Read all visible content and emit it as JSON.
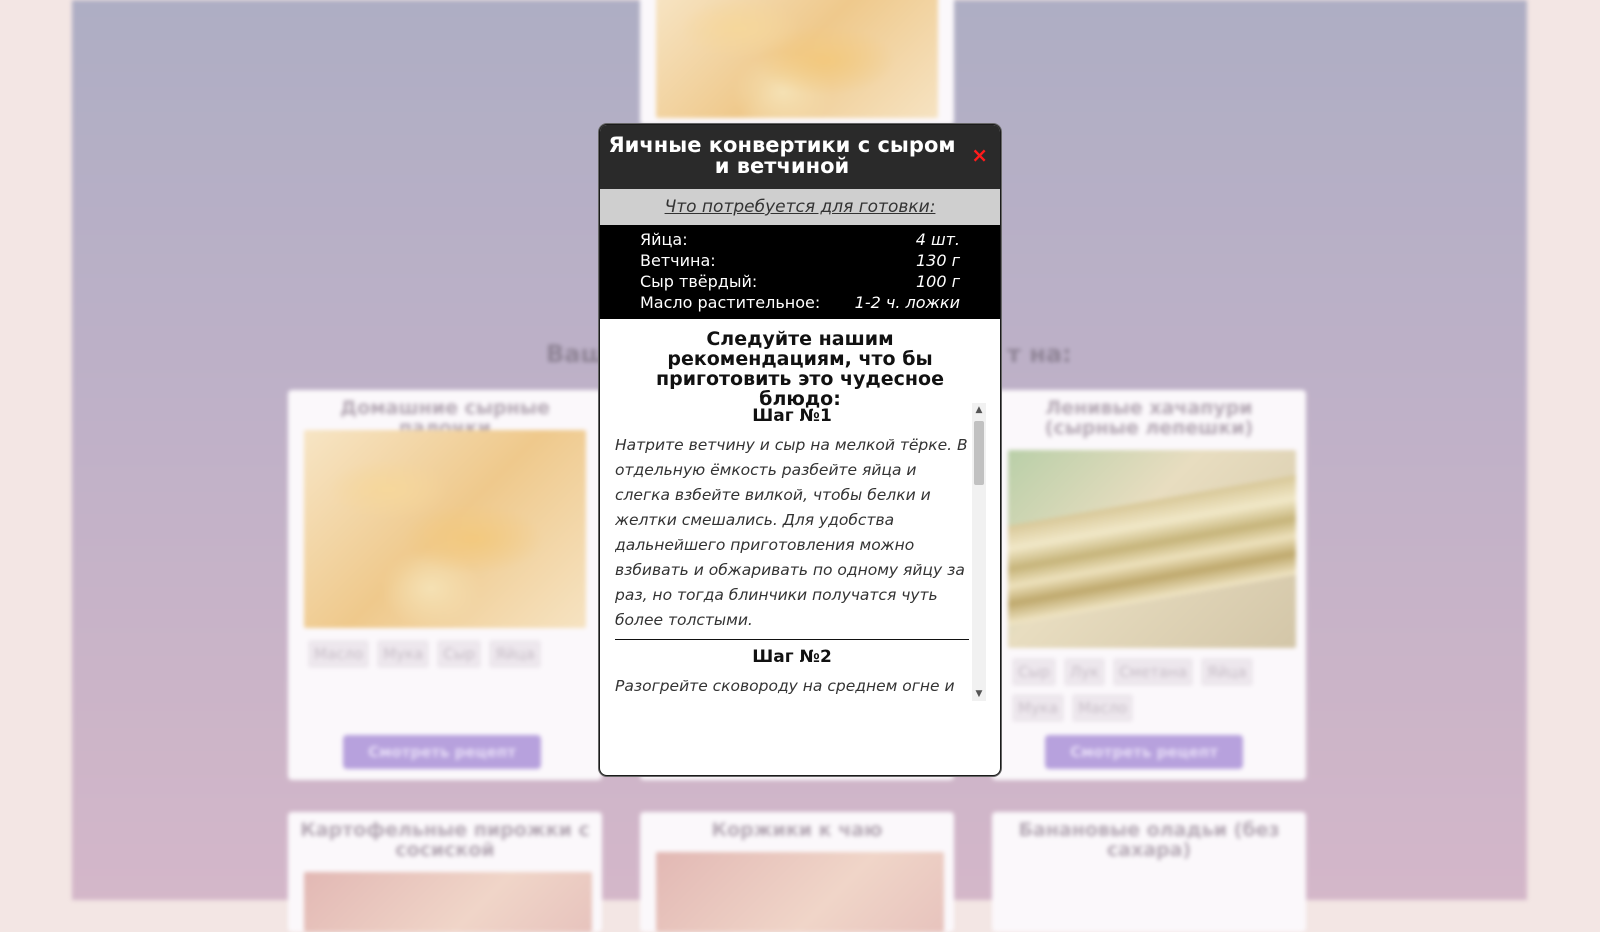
{
  "background": {
    "section_heading_left": "Ваш",
    "section_heading_right": "т на:",
    "top_card": {
      "image": "cheese-sticks-photo"
    },
    "cards": [
      {
        "title": "Домашние сырные палочки",
        "tags": [
          "Масло",
          "Мука",
          "Сыр",
          "Яйца"
        ],
        "button": "Смотреть рецепт"
      },
      {
        "title": "Ленивые хачапури (сырные лепешки)",
        "tags": [
          "Сыр",
          "Лук",
          "Сметана",
          "Яйца",
          "Мука",
          "Масло"
        ],
        "button": "Смотреть рецепт"
      },
      {
        "title": "Картофельные пирожки с сосиской"
      },
      {
        "title": "Коржики к чаю"
      },
      {
        "title": "Банановые оладьи (без сахара)"
      }
    ]
  },
  "modal": {
    "title": "Яичные конвертики с сыром и ветчиной",
    "close_label": "×",
    "ingredients_heading": "Что потребуется для готовки:",
    "ingredients": [
      {
        "name": "Яйца:",
        "amount": "4 шт."
      },
      {
        "name": "Ветчина:",
        "amount": "130 г"
      },
      {
        "name": "Сыр твёрдый:",
        "amount": "100 г"
      },
      {
        "name": "Масло растительное:",
        "amount": "1-2 ч. ложки"
      }
    ],
    "advice": "Следуйте нашим рекомендациям, что бы приготовить это чудесное блюдо:",
    "steps": [
      {
        "title": "Шаг №1",
        "text": "Натрите ветчину и сыр на мелкой тёрке. В отдельную ёмкость разбейте яйца и слегка взбейте вилкой, чтобы белки и желтки смешались. Для удобства дальнейшего приготовления можно взбивать и обжаривать по одному яйцу за раз, но тогда блинчики получатся чуть более толстыми."
      },
      {
        "title": "Шаг №2",
        "text": "Разогрейте сковороду на среднем огне и"
      }
    ],
    "scroll_up": "▲",
    "scroll_down": "▼"
  }
}
